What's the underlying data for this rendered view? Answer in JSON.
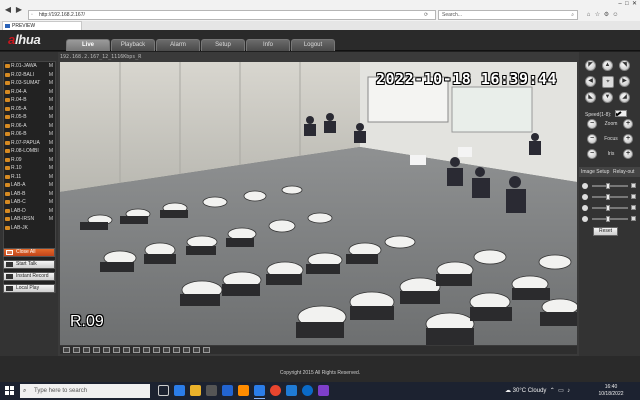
{
  "browser": {
    "url": "http://192.168.2.167/",
    "search_placeholder": "Search...",
    "tab_title": "PREVIEW"
  },
  "app": {
    "logo_a": "a",
    "logo_rest": "lhua",
    "nav": [
      {
        "label": "Live",
        "active": true
      },
      {
        "label": "Playback"
      },
      {
        "label": "Alarm"
      },
      {
        "label": "Setup"
      },
      {
        "label": "Info"
      },
      {
        "label": "Logout"
      }
    ]
  },
  "channels": [
    {
      "label": "R.01-JAWA",
      "flag": "M"
    },
    {
      "label": "R.02-BALI",
      "flag": "M"
    },
    {
      "label": "R.03-SUMAT",
      "flag": "M"
    },
    {
      "label": "R.04-A",
      "flag": "M"
    },
    {
      "label": "R.04-B",
      "flag": "M"
    },
    {
      "label": "R.05-A",
      "flag": "M"
    },
    {
      "label": "R.05-B",
      "flag": "M"
    },
    {
      "label": "R.06-A",
      "flag": "M"
    },
    {
      "label": "R.06-B",
      "flag": "M"
    },
    {
      "label": "R.07-PAPUA",
      "flag": "M"
    },
    {
      "label": "R.08-LOMBI",
      "flag": "M"
    },
    {
      "label": "R.09",
      "flag": "M"
    },
    {
      "label": "R.10",
      "flag": "M"
    },
    {
      "label": "R.11",
      "flag": "M"
    },
    {
      "label": "LAB-A",
      "flag": "M"
    },
    {
      "label": "LAB-B",
      "flag": "M"
    },
    {
      "label": "LAB-C",
      "flag": "M"
    },
    {
      "label": "LAB-D",
      "flag": "M"
    },
    {
      "label": "LAB-IRSN",
      "flag": "M"
    },
    {
      "label": "LAB-JK",
      "flag": ""
    }
  ],
  "side_buttons": {
    "close_all": "Close All",
    "start_talk": "Start Talk",
    "instant_record": "Instant Record",
    "local_play": "Local Play"
  },
  "video": {
    "stream_info": "192.168.2.167_12_1116Kbps_R",
    "osd_timestamp": "2022-10-18 16:39:44",
    "osd_camera_name": "R.09"
  },
  "ptz": {
    "speed_label": "Speed(1-8):",
    "speed_value": "5",
    "zoom_label": "Zoom",
    "focus_label": "Focus",
    "iris_label": "Iris",
    "minus": "−",
    "plus": "+",
    "image_setup": "Image Setup",
    "relay_out": "Relay-out",
    "reset": "Reset"
  },
  "footer": {
    "copyright": "Copyright 2015 All Rights Reserved."
  },
  "taskbar": {
    "search_placeholder": "Type here to search",
    "weather": "30°C  Cloudy",
    "time": "16:40",
    "date": "10/18/2022"
  },
  "colors": {
    "accent_orange": "#d68a22",
    "brand_red": "#c8161d",
    "active_btn": "#d0531f"
  }
}
